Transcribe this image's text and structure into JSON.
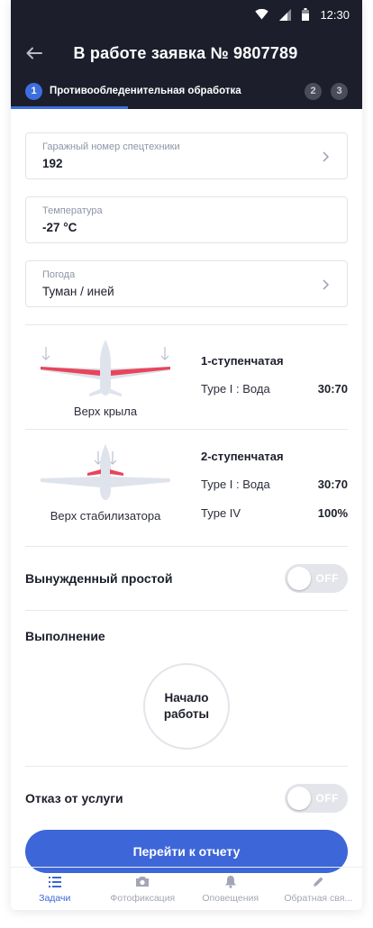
{
  "status_bar": {
    "time": "12:30",
    "icons": [
      "wifi-icon",
      "signal-icon",
      "battery-icon"
    ]
  },
  "header": {
    "title": "В работе заявка № 9807789",
    "back_icon": "arrow-left-icon"
  },
  "stepper": {
    "active_step": {
      "number": "1",
      "label": "Противообледенительная обработка"
    },
    "other_steps": [
      "2",
      "3"
    ]
  },
  "fields": {
    "garage": {
      "label": "Гаражный номер спецтехники",
      "value": "192"
    },
    "temperature": {
      "label": "Температура",
      "value": "-27 °C"
    },
    "weather": {
      "label": "Погода",
      "value": "Туман / иней"
    }
  },
  "treatments": [
    {
      "caption": "Верх крыла",
      "title": "1-ступенчатая",
      "lines": [
        {
          "label": "Type I : Вода",
          "value": "30:70"
        }
      ]
    },
    {
      "caption": "Верх стабилизатора",
      "title": "2-ступенчатая",
      "lines": [
        {
          "label": "Type I : Вода",
          "value": "30:70"
        },
        {
          "label": "Type IV",
          "value": "100%"
        }
      ]
    }
  ],
  "forced_idle": {
    "label": "Вынужденный простой",
    "toggle": "OFF"
  },
  "execution": {
    "title": "Выполнение",
    "start_line1": "Начало",
    "start_line2": "работы"
  },
  "refusal": {
    "label": "Отказ от услуги",
    "toggle": "OFF"
  },
  "cta": {
    "label": "Перейти к отчету"
  },
  "tabbar": [
    {
      "label": "Задачи",
      "icon": "list-icon",
      "active": true
    },
    {
      "label": "Фотофиксация",
      "icon": "camera-icon",
      "active": false
    },
    {
      "label": "Оповещения",
      "icon": "bell-icon",
      "active": false
    },
    {
      "label": "Обратная свя...",
      "icon": "pencil-icon",
      "active": false
    }
  ],
  "colors": {
    "header_bg": "#1c1e2c",
    "accent": "#3d66d8",
    "highlight_red": "#e8455b",
    "toggle_off": "#e3e5eb"
  }
}
